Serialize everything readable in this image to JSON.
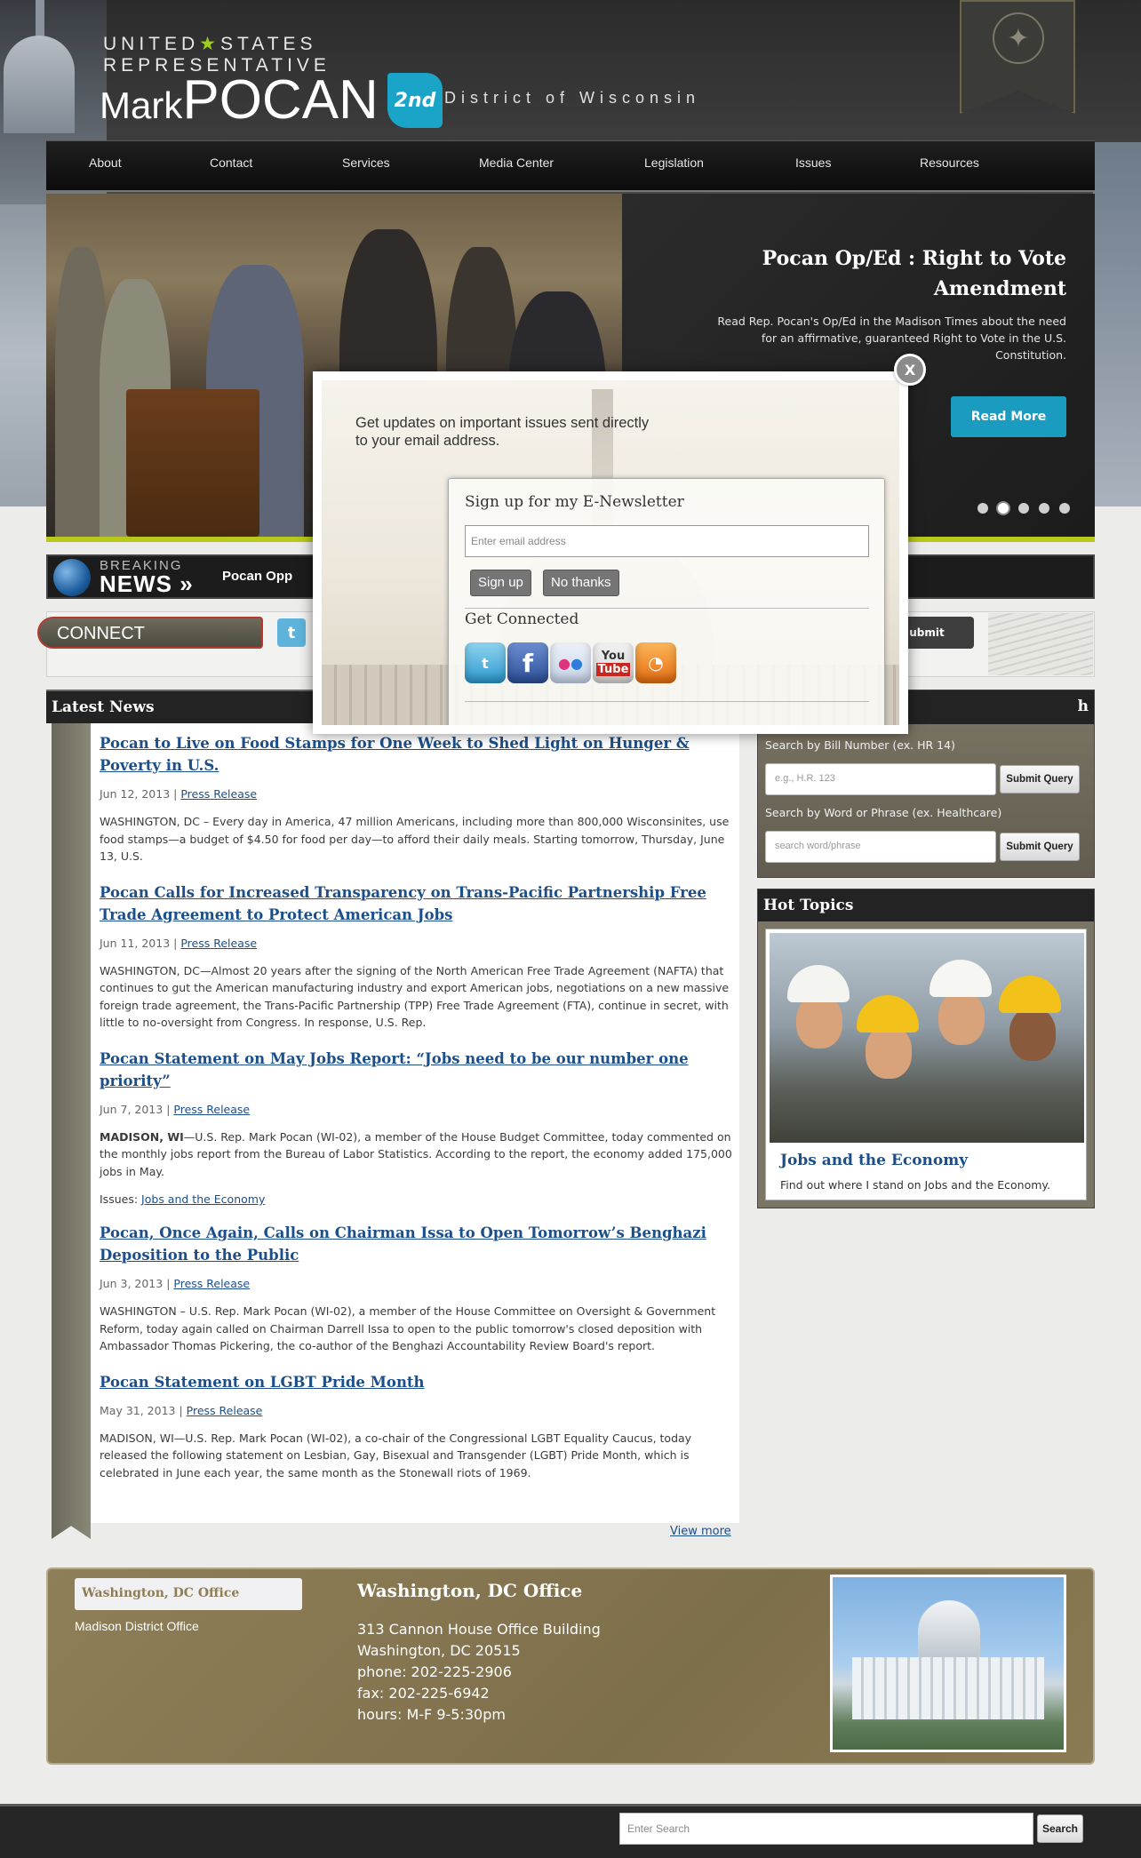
{
  "header": {
    "logo_line1": "UNITED",
    "logo_line1b": "STATES",
    "logo_line2": "REPRESENTATIVE",
    "logo_first": "Mark",
    "logo_last": "POCAN",
    "badge": "2nd",
    "district": "District of Wisconsin"
  },
  "nav": {
    "items": [
      "About",
      "Contact",
      "Services",
      "Media Center",
      "Legislation",
      "Issues",
      "Resources"
    ]
  },
  "hero": {
    "title": "Pocan Op/Ed : Right to Vote Amendment",
    "text": "Read Rep. Pocan's Op/Ed in the Madison Times about the need for an affirmative, guaranteed Right to Vote in the U.S. Constitution.",
    "button": "Read More",
    "slide_count": 5,
    "active_slide": 2
  },
  "breaking": {
    "word1": "BREAKING",
    "word2": "NEWS",
    "ticker": "Pocan Opp"
  },
  "connect": {
    "label": "CONNECT",
    "submit": "ubmit"
  },
  "latest": {
    "heading": "Latest News",
    "articles": [
      {
        "title": "Pocan to Live on Food Stamps for One Week to Shed Light on Hunger & Poverty in U.S.",
        "date": "Jun 12, 2013 |",
        "category": "Press Release",
        "body": "WASHINGTON, DC – Every day in America, 47 million Americans, including more than 800,000 Wisconsinites, use food stamps—a budget of $4.50 for food per day—to afford their daily meals. Starting tomorrow, Thursday, June 13, U.S."
      },
      {
        "title": "Pocan Calls for Increased Transparency on Trans-Pacific Partnership Free Trade Agreement to Protect American Jobs",
        "date": "Jun 11, 2013 |",
        "category": "Press Release",
        "body": "WASHINGTON, DC—Almost 20 years after the signing of the North American Free Trade Agreement (NAFTA) that continues to gut the American manufacturing industry and export American jobs, negotiations on a new massive foreign trade agreement, the Trans-Pacific Partnership (TPP) Free Trade Agreement (FTA), continue in secret, with little to no-oversight from Congress. In response, U.S. Rep."
      },
      {
        "title": "Pocan Statement on May Jobs Report: “Jobs need to be our number one priority”",
        "date": "Jun 7, 2013 |",
        "category": "Press Release",
        "body_lead": "MADISON, WI",
        "body": "—U.S. Rep. Mark Pocan (WI-02), a member of the House Budget Committee, today commented on the monthly jobs report from the Bureau of Labor Statistics.  According to the report, the economy added 175,000 jobs in May.",
        "issues_label": "Issues:",
        "issues_link": "Jobs and the Economy"
      },
      {
        "title": "Pocan, Once Again, Calls on Chairman Issa to Open Tomorrow’s Benghazi Deposition to the Public",
        "date": "Jun 3, 2013 |",
        "category": "Press Release",
        "body": "WASHINGTON – U.S. Rep. Mark Pocan (WI-02), a member of the House Committee on Oversight & Government Reform, today again called on Chairman Darrell Issa to open to the public tomorrow's closed deposition with Ambassador Thomas Pickering, the co-author of the Benghazi Accountability Review Board's report."
      },
      {
        "title": "Pocan Statement on LGBT Pride Month",
        "date": "May 31, 2013 |",
        "category": "Press Release",
        "body": "MADISON, WI—U.S. Rep. Mark Pocan (WI-02), a co-chair of the Congressional LGBT Equality Caucus, today released the following statement on Lesbian, Gay, Bisexual and Transgender (LGBT) Pride Month, which is celebrated in June each year, the same month as the Stonewall riots of 1969."
      }
    ],
    "view_more": "View more"
  },
  "search": {
    "heading": "h",
    "bill_label": "Search by Bill Number (ex. HR 14)",
    "bill_placeholder": "e.g., H.R. 123",
    "phrase_label": "Search by Word or Phrase (ex. Healthcare)",
    "phrase_placeholder": "search word/phrase",
    "submit": "Submit Query"
  },
  "hot_topics": {
    "heading": "Hot Topics",
    "title": "Jobs and the Economy",
    "text": "Find out where I stand on Jobs and the Economy."
  },
  "office": {
    "tab_active": "Washington, DC Office",
    "tab_other": "Madison District Office",
    "title": "Washington, DC Office",
    "lines": [
      "313 Cannon House Office Building",
      "Washington, DC 20515",
      "phone: 202-225-2906",
      "fax: 202-225-6942",
      "hours: M-F 9-5:30pm"
    ]
  },
  "footer": {
    "search_placeholder": "Enter Search",
    "search_button": "Search"
  },
  "modal": {
    "intro": "Get updates on important issues sent directly to your email address.",
    "title": "Sign up for my E-Newsletter",
    "email_placeholder": "Enter email address",
    "signup": "Sign up",
    "no_thanks": "No thanks",
    "connected": "Get Connected",
    "close": "X",
    "social_icons": [
      "twitter-icon",
      "facebook-icon",
      "flickr-icon",
      "youtube-icon",
      "rss-icon"
    ],
    "youtube_text_1": "You",
    "youtube_text_2": "Tube"
  },
  "colors": {
    "accent_blue": "#1a9bc0",
    "link_blue": "#1c4f8a",
    "hero_stripe": "#b9c91b",
    "office_brown": "#8f7f58"
  }
}
